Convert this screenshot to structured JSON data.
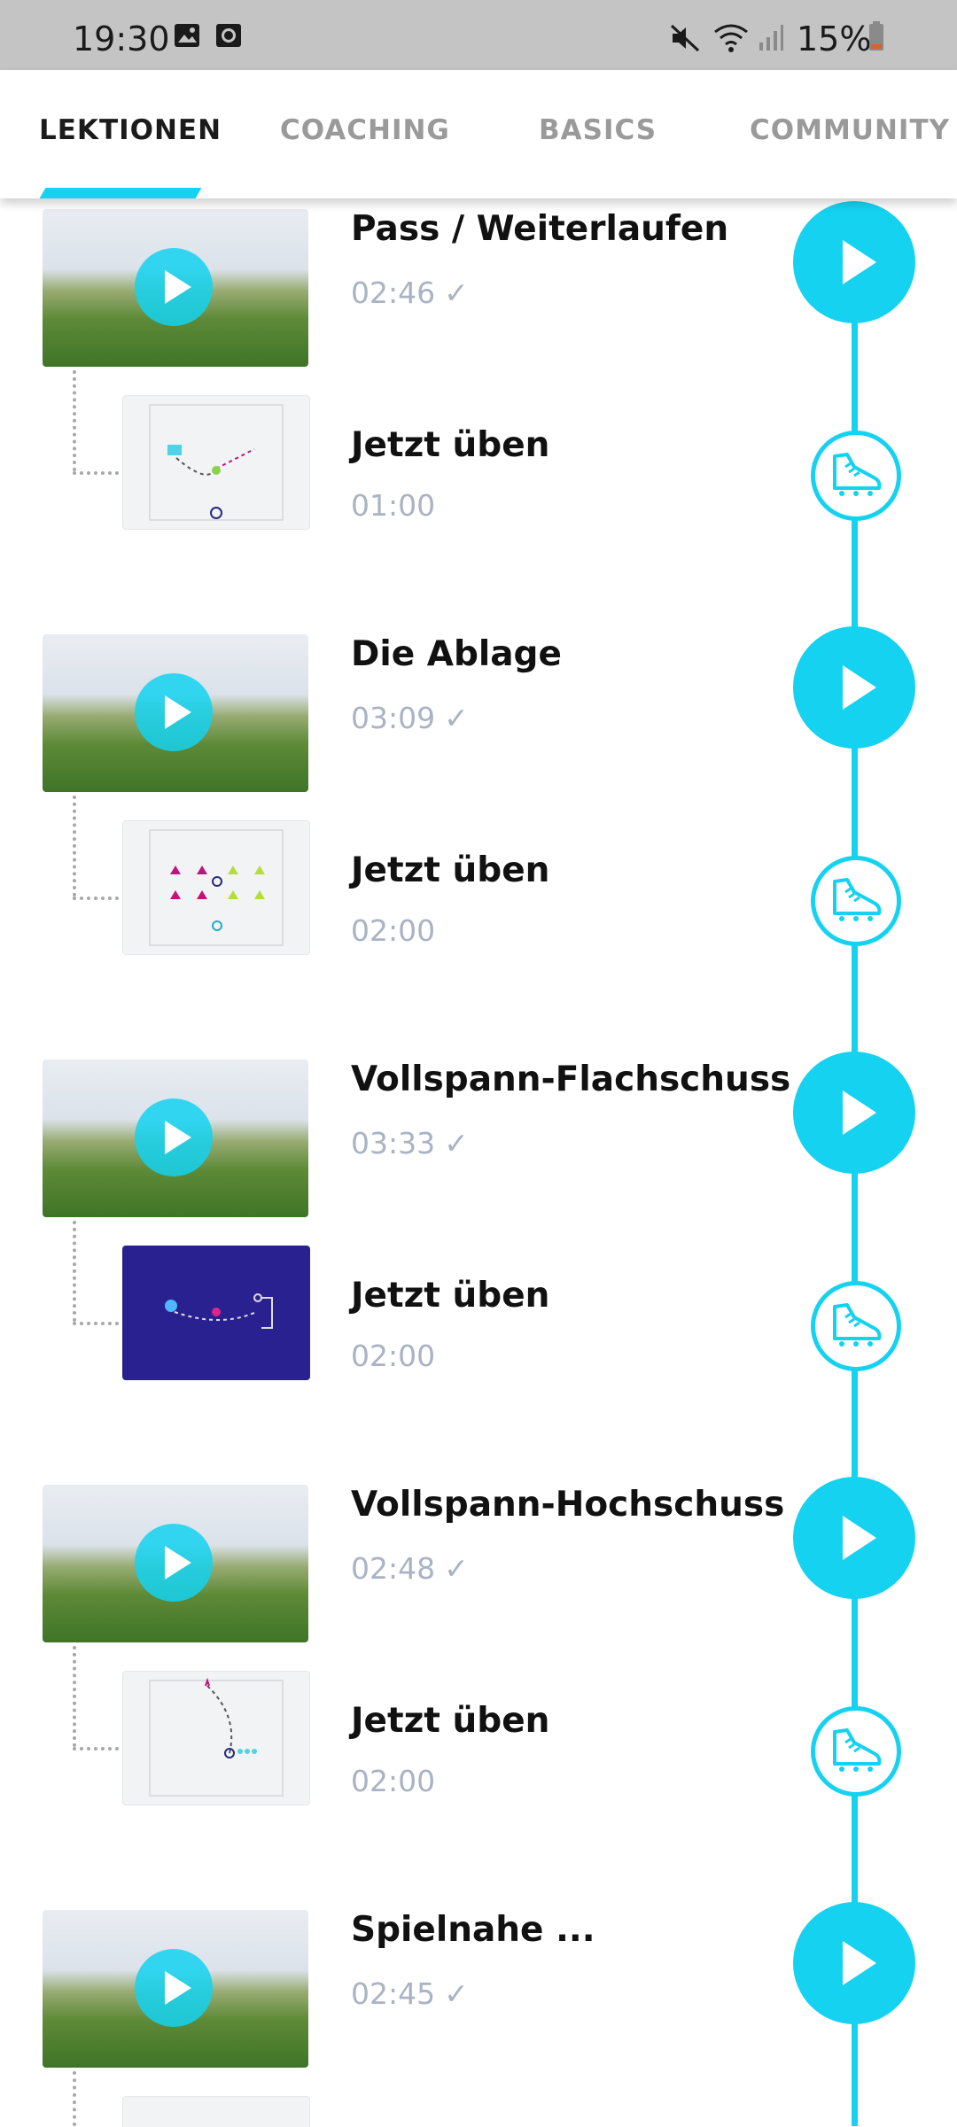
{
  "status_bar": {
    "time": "19:30",
    "battery": "15%"
  },
  "tabs": [
    {
      "label": "LEKTIONEN",
      "active": true
    },
    {
      "label": "COACHING",
      "active": false
    },
    {
      "label": "BASICS",
      "active": false
    },
    {
      "label": "COMMUNITY",
      "active": false
    }
  ],
  "lessons": [
    {
      "title": "Pass / Weiterlaufen",
      "duration": "02:46",
      "check": "✓",
      "practice": {
        "title": "Jetzt üben",
        "duration": "01:00"
      }
    },
    {
      "title": "Die Ablage",
      "duration": "03:09",
      "check": "✓",
      "practice": {
        "title": "Jetzt üben",
        "duration": "02:00"
      }
    },
    {
      "title": "Vollspann-Flachschuss",
      "duration": "03:33",
      "check": "✓",
      "practice": {
        "title": "Jetzt üben",
        "duration": "02:00"
      }
    },
    {
      "title": "Vollspann-Hochschuss",
      "duration": "02:48",
      "check": "✓",
      "practice": {
        "title": "Jetzt üben",
        "duration": "02:00"
      }
    },
    {
      "title": "Spielnahe ...",
      "duration": "02:45",
      "check": "✓"
    }
  ],
  "colors": {
    "accent": "#14d2f0",
    "muted_text": "#a9b3c4"
  }
}
